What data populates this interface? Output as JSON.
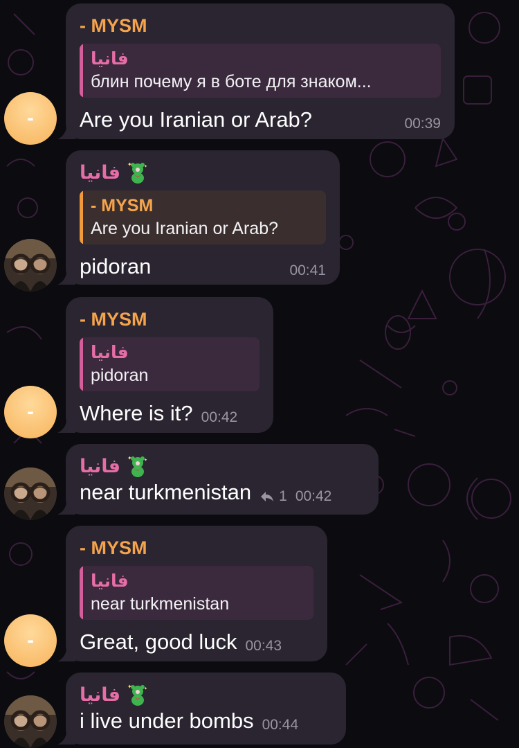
{
  "messages": [
    {
      "sender": "- MYSM",
      "reply_name": "فانيا",
      "reply_text": "блин почему я в боте для знаком...",
      "text": "Are you Iranian or Arab?",
      "time": "00:39"
    },
    {
      "sender": "فانيا",
      "reply_name": "- MYSM",
      "reply_text": "Are you Iranian or Arab?",
      "text": "pidoran",
      "time": "00:41"
    },
    {
      "sender": "- MYSM",
      "reply_name": "فانيا",
      "reply_text": "pidoran",
      "text": "Where is it?",
      "time": "00:42"
    },
    {
      "sender": "فانيا",
      "text": "near turkmenistan",
      "reply_count": "1",
      "time": "00:42"
    },
    {
      "sender": "- MYSM",
      "reply_name": "فانيا",
      "reply_text": "near turkmenistan",
      "text": "Great, good luck",
      "time": "00:43"
    },
    {
      "sender": "فانيا",
      "text": "i live under bombs",
      "time": "00:44"
    }
  ],
  "avatars": {
    "mysm_initial": "-"
  },
  "colors": {
    "bubble": "#2a2530",
    "orange": "#f6a44c",
    "pink": "#e56ea7",
    "time": "#9a95a2"
  }
}
